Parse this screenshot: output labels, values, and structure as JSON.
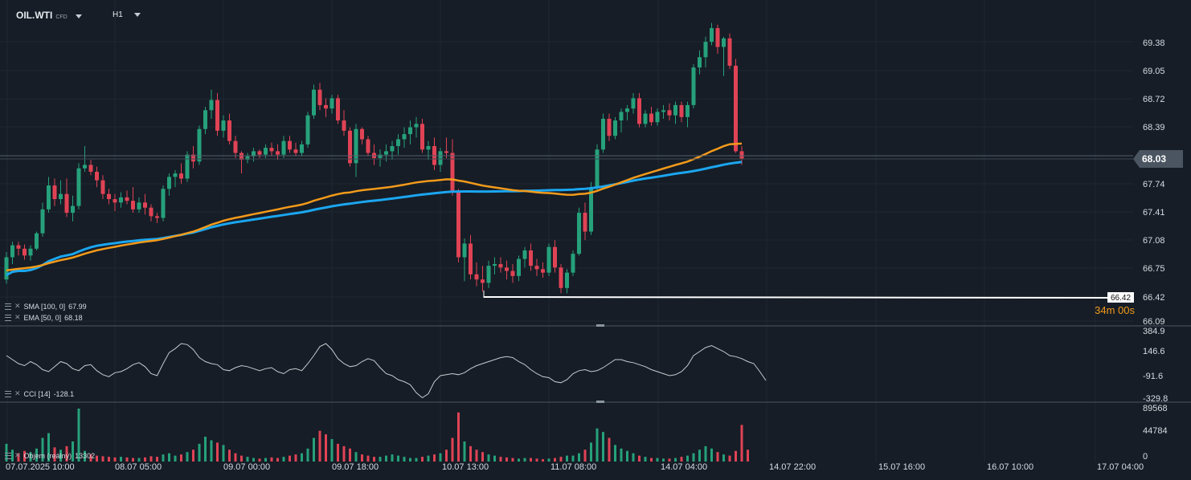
{
  "header": {
    "symbol": "OIL.WTI",
    "symbol_tag": "CFD",
    "timeframe": "H1"
  },
  "price_axis": {
    "labels": [
      "69.38",
      "69.05",
      "68.72",
      "68.39",
      "68.03",
      "67.74",
      "67.41",
      "67.08",
      "66.75",
      "66.42",
      "66.09"
    ]
  },
  "current_price": "68.03",
  "order_line": {
    "price": "66.42",
    "countdown_min": "34m",
    "countdown_sec": " 00s"
  },
  "indicators": {
    "sma": {
      "label": "SMA [100,  0]",
      "value": "67.99"
    },
    "ema": {
      "label": "EMA [50,  0]",
      "value": "68.18"
    },
    "cci": {
      "label": "CCI [14]",
      "value": "-128.1",
      "axis": [
        "384.9",
        "146.6",
        "-91.6",
        "-329.8"
      ]
    },
    "volume": {
      "label": "Objem  (reálný)",
      "value": "13302",
      "axis": [
        "89568",
        "44784",
        "0"
      ]
    }
  },
  "time_axis": [
    "07.07.2025  10:00",
    "08.07  05:00",
    "09.07  00:00",
    "09.07  18:00",
    "10.07  13:00",
    "11.07  08:00",
    "14.07  04:00",
    "14.07  22:00",
    "15.07  16:00",
    "16.07  10:00",
    "17.07  04:00"
  ],
  "colors": {
    "bg": "#161d26",
    "up": "#26a17b",
    "down": "#e04355",
    "sma": "#1ba6f0",
    "ema": "#f39a1b",
    "grid": "#1f2832"
  },
  "chart_data": {
    "type": "candlestick",
    "interval": "H1",
    "ohlc": [
      [
        66.62,
        66.94,
        66.57,
        66.88
      ],
      [
        66.88,
        67.06,
        66.8,
        67.02
      ],
      [
        67.02,
        67.06,
        66.9,
        66.98
      ],
      [
        66.98,
        67.03,
        66.85,
        66.9
      ],
      [
        66.9,
        67.02,
        66.84,
        66.98
      ],
      [
        66.98,
        67.18,
        66.96,
        67.16
      ],
      [
        67.16,
        67.52,
        67.12,
        67.44
      ],
      [
        67.44,
        67.82,
        67.4,
        67.72
      ],
      [
        67.72,
        67.8,
        67.48,
        67.56
      ],
      [
        67.56,
        67.78,
        67.5,
        67.62
      ],
      [
        67.62,
        67.8,
        67.35,
        67.4
      ],
      [
        67.4,
        67.6,
        67.3,
        67.48
      ],
      [
        67.48,
        67.98,
        67.44,
        67.92
      ],
      [
        67.92,
        68.18,
        67.88,
        67.96
      ],
      [
        67.96,
        68.02,
        67.84,
        67.88
      ],
      [
        67.88,
        67.94,
        67.7,
        67.78
      ],
      [
        67.78,
        67.84,
        67.56,
        67.62
      ],
      [
        67.62,
        67.68,
        67.5,
        67.56
      ],
      [
        67.56,
        67.62,
        67.42,
        67.52
      ],
      [
        67.52,
        67.64,
        67.46,
        67.58
      ],
      [
        67.58,
        67.66,
        67.5,
        67.54
      ],
      [
        67.54,
        67.7,
        67.4,
        67.44
      ],
      [
        67.44,
        67.58,
        67.4,
        67.52
      ],
      [
        67.52,
        67.62,
        67.38,
        67.46
      ],
      [
        67.46,
        67.5,
        67.3,
        67.36
      ],
      [
        67.36,
        67.4,
        67.28,
        67.34
      ],
      [
        67.34,
        67.72,
        67.3,
        67.68
      ],
      [
        67.68,
        67.86,
        67.6,
        67.82
      ],
      [
        67.82,
        67.9,
        67.7,
        67.86
      ],
      [
        67.86,
        67.98,
        67.74,
        67.8
      ],
      [
        67.8,
        68.12,
        67.76,
        68.08
      ],
      [
        68.08,
        68.18,
        67.92,
        68.0
      ],
      [
        68.0,
        68.42,
        67.96,
        68.38
      ],
      [
        68.38,
        68.64,
        68.32,
        68.6
      ],
      [
        68.6,
        68.84,
        68.5,
        68.72
      ],
      [
        68.72,
        68.8,
        68.3,
        68.36
      ],
      [
        68.36,
        68.54,
        68.28,
        68.48
      ],
      [
        68.48,
        68.56,
        68.2,
        68.24
      ],
      [
        68.24,
        68.3,
        68.04,
        68.1
      ],
      [
        68.1,
        68.12,
        67.86,
        68.02
      ],
      [
        68.02,
        68.1,
        67.98,
        68.06
      ],
      [
        68.06,
        68.16,
        68.0,
        68.12
      ],
      [
        68.12,
        68.14,
        68.04,
        68.08
      ],
      [
        68.08,
        68.2,
        68.04,
        68.16
      ],
      [
        68.16,
        68.22,
        68.06,
        68.12
      ],
      [
        68.12,
        68.2,
        68.02,
        68.08
      ],
      [
        68.08,
        68.3,
        68.04,
        68.24
      ],
      [
        68.24,
        68.3,
        68.1,
        68.14
      ],
      [
        68.14,
        68.22,
        68.06,
        68.1
      ],
      [
        68.1,
        68.24,
        68.06,
        68.2
      ],
      [
        68.2,
        68.58,
        68.16,
        68.54
      ],
      [
        68.54,
        68.9,
        68.5,
        68.84
      ],
      [
        68.84,
        68.92,
        68.6,
        68.66
      ],
      [
        68.66,
        68.74,
        68.52,
        68.62
      ],
      [
        68.62,
        68.78,
        68.56,
        68.74
      ],
      [
        68.74,
        68.78,
        68.44,
        68.48
      ],
      [
        68.48,
        68.6,
        68.3,
        68.36
      ],
      [
        68.36,
        68.4,
        67.94,
        67.98
      ],
      [
        67.98,
        68.44,
        67.82,
        68.38
      ],
      [
        68.38,
        68.4,
        68.2,
        68.26
      ],
      [
        68.26,
        68.3,
        68.06,
        68.1
      ],
      [
        68.1,
        68.2,
        67.96,
        68.04
      ],
      [
        68.04,
        68.14,
        67.94,
        68.08
      ],
      [
        68.08,
        68.2,
        68.0,
        68.12
      ],
      [
        68.12,
        68.24,
        68.02,
        68.18
      ],
      [
        68.18,
        68.32,
        68.08,
        68.26
      ],
      [
        68.26,
        68.4,
        68.16,
        68.32
      ],
      [
        68.32,
        68.48,
        68.2,
        68.4
      ],
      [
        68.4,
        68.52,
        68.28,
        68.44
      ],
      [
        68.44,
        68.5,
        68.1,
        68.14
      ],
      [
        68.14,
        68.24,
        68.02,
        68.18
      ],
      [
        68.18,
        68.28,
        67.9,
        67.96
      ],
      [
        67.96,
        68.16,
        67.88,
        68.12
      ],
      [
        68.12,
        68.28,
        68.04,
        68.1
      ],
      [
        68.1,
        68.26,
        67.6,
        67.66
      ],
      [
        67.66,
        67.68,
        66.82,
        66.88
      ],
      [
        66.88,
        67.1,
        66.6,
        67.04
      ],
      [
        67.04,
        67.14,
        66.62,
        66.68
      ],
      [
        66.68,
        66.82,
        66.54,
        66.62
      ],
      [
        66.62,
        66.78,
        66.48,
        66.58
      ],
      [
        66.58,
        66.84,
        66.52,
        66.78
      ],
      [
        66.78,
        66.88,
        66.68,
        66.8
      ],
      [
        66.8,
        66.88,
        66.7,
        66.76
      ],
      [
        66.76,
        66.84,
        66.62,
        66.72
      ],
      [
        66.72,
        66.8,
        66.58,
        66.66
      ],
      [
        66.66,
        66.9,
        66.6,
        66.86
      ],
      [
        66.86,
        67.0,
        66.76,
        66.96
      ],
      [
        66.96,
        67.04,
        66.72,
        66.78
      ],
      [
        66.78,
        66.86,
        66.66,
        66.74
      ],
      [
        66.74,
        66.82,
        66.64,
        66.7
      ],
      [
        66.7,
        67.04,
        66.66,
        67.0
      ],
      [
        67.0,
        67.08,
        66.7,
        66.76
      ],
      [
        66.76,
        66.8,
        66.46,
        66.52
      ],
      [
        66.52,
        66.74,
        66.46,
        66.7
      ],
      [
        66.7,
        66.96,
        66.66,
        66.92
      ],
      [
        66.92,
        67.46,
        66.9,
        67.4
      ],
      [
        67.4,
        67.52,
        67.08,
        67.18
      ],
      [
        67.18,
        67.76,
        67.14,
        67.7
      ],
      [
        67.7,
        68.2,
        67.66,
        68.14
      ],
      [
        68.14,
        68.56,
        68.1,
        68.5
      ],
      [
        68.5,
        68.56,
        68.24,
        68.3
      ],
      [
        68.3,
        68.52,
        68.26,
        68.48
      ],
      [
        68.48,
        68.62,
        68.34,
        68.58
      ],
      [
        68.58,
        68.66,
        68.48,
        68.62
      ],
      [
        68.62,
        68.8,
        68.56,
        68.74
      ],
      [
        68.74,
        68.8,
        68.4,
        68.44
      ],
      [
        68.44,
        68.6,
        68.4,
        68.56
      ],
      [
        68.56,
        68.64,
        68.42,
        68.46
      ],
      [
        68.46,
        68.62,
        68.42,
        68.58
      ],
      [
        68.58,
        68.66,
        68.5,
        68.6
      ],
      [
        68.6,
        68.68,
        68.48,
        68.54
      ],
      [
        68.54,
        68.7,
        68.44,
        68.66
      ],
      [
        68.66,
        68.7,
        68.46,
        68.52
      ],
      [
        68.52,
        68.7,
        68.4,
        68.66
      ],
      [
        68.66,
        69.14,
        68.62,
        69.1
      ],
      [
        69.1,
        69.3,
        69.02,
        69.22
      ],
      [
        69.22,
        69.46,
        69.1,
        69.4
      ],
      [
        69.4,
        69.62,
        69.36,
        69.56
      ],
      [
        69.56,
        69.6,
        69.26,
        69.34
      ],
      [
        69.34,
        69.46,
        69.0,
        69.44
      ],
      [
        69.44,
        69.5,
        69.08,
        69.12
      ],
      [
        69.12,
        69.2,
        68.1,
        68.12
      ],
      [
        68.12,
        68.18,
        67.96,
        68.03
      ]
    ],
    "sma": {
      "name": "SMA [100,  0]",
      "start": 66.5,
      "end": 67.99
    },
    "ema": {
      "name": "EMA [50,  0]",
      "start": 66.6,
      "end": 68.18
    },
    "cci": [
      120,
      80,
      40,
      20,
      60,
      30,
      -20,
      -40,
      10,
      60,
      40,
      -10,
      -30,
      20,
      30,
      -30,
      -70,
      -90,
      -50,
      -40,
      -10,
      30,
      50,
      10,
      -60,
      -80,
      40,
      150,
      190,
      240,
      230,
      180,
      100,
      60,
      40,
      30,
      -20,
      -30,
      0,
      20,
      10,
      -10,
      -30,
      -10,
      0,
      -40,
      -60,
      -20,
      -10,
      -30,
      40,
      120,
      210,
      240,
      180,
      90,
      40,
      10,
      20,
      60,
      90,
      70,
      0,
      -60,
      -80,
      -120,
      -140,
      -170,
      -250,
      -300,
      -260,
      -140,
      -80,
      -70,
      -60,
      -70,
      -50,
      -10,
      20,
      40,
      60,
      80,
      100,
      110,
      100,
      60,
      30,
      -20,
      -60,
      -90,
      -100,
      -140,
      -150,
      -120,
      -60,
      -30,
      -20,
      -40,
      -30,
      0,
      40,
      80,
      80,
      60,
      50,
      30,
      10,
      -20,
      -40,
      -60,
      -80,
      -70,
      -40,
      20,
      120,
      160,
      200,
      220,
      190,
      160,
      120,
      110,
      90,
      60,
      40,
      -40,
      -128
    ],
    "volume": [
      30000,
      20000,
      14000,
      18000,
      16000,
      22000,
      40000,
      48000,
      24000,
      20000,
      26000,
      34000,
      89568,
      18000,
      12000,
      10000,
      9000,
      8000,
      7000,
      8000,
      7000,
      6000,
      6000,
      7000,
      9000,
      8000,
      12000,
      14000,
      10000,
      12000,
      16000,
      20000,
      30000,
      42000,
      36000,
      32000,
      28000,
      20000,
      14000,
      10000,
      8000,
      6000,
      5000,
      6000,
      7000,
      6000,
      8000,
      10000,
      12000,
      14000,
      22000,
      40000,
      52000,
      46000,
      38000,
      30000,
      26000,
      22000,
      16000,
      12000,
      10000,
      8000,
      8000,
      10000,
      12000,
      10000,
      8000,
      6000,
      6000,
      8000,
      10000,
      12000,
      14000,
      20000,
      40000,
      83000,
      34000,
      26000,
      20000,
      16000,
      12000,
      10000,
      8000,
      7000,
      6000,
      5000,
      6000,
      6000,
      5000,
      4000,
      5000,
      6000,
      8000,
      10000,
      10000,
      14000,
      20000,
      32000,
      56000,
      50000,
      40000,
      28000,
      22000,
      18000,
      14000,
      10000,
      8000,
      6000,
      6000,
      5000,
      5000,
      6000,
      8000,
      10000,
      14000,
      20000,
      26000,
      22000,
      16000,
      12000,
      10000,
      18000,
      62000,
      20000
    ]
  }
}
